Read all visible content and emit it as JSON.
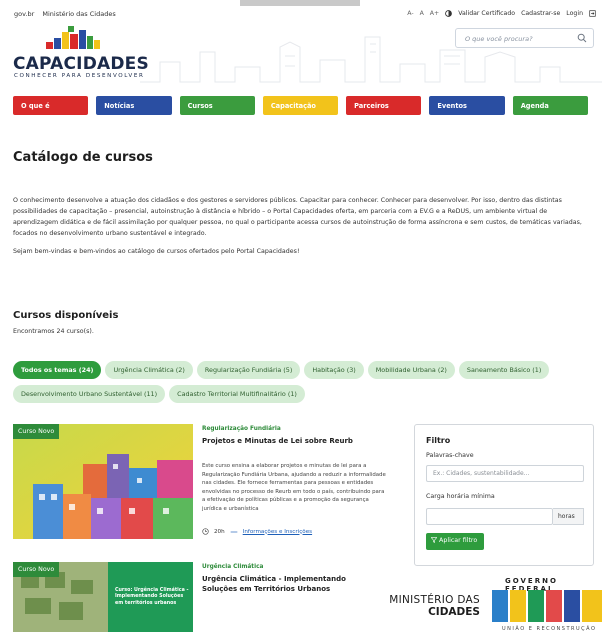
{
  "govbar": {
    "left_links": [
      "gov.br",
      "Ministério das Cidades"
    ],
    "a_minus": "A-",
    "a_normal": "A",
    "a_plus": "A+",
    "contrast_icon": "contrast-icon",
    "validar": "Validar Certificado",
    "cadastrar": "Cadastrar-se",
    "login": "Login"
  },
  "header": {
    "logo_title": "CAPACIDADES",
    "logo_subtitle": "CONHECER PARA DESENVOLVER",
    "search_placeholder": "O que você procura?"
  },
  "nav": [
    {
      "label": "O que é",
      "color": "#d92a2a"
    },
    {
      "label": "Notícias",
      "color": "#2a4ea2"
    },
    {
      "label": "Cursos",
      "color": "#3b9c3e"
    },
    {
      "label": "Capacitação",
      "color": "#f2c31b"
    },
    {
      "label": "Parceiros",
      "color": "#d92a2a"
    },
    {
      "label": "Eventos",
      "color": "#2a4ea2"
    },
    {
      "label": "Agenda",
      "color": "#3b9c3e"
    }
  ],
  "main": {
    "title": "Catálogo de cursos",
    "intro": "O conhecimento desenvolve a atuação dos cidadãos e dos gestores e servidores públicos. Capacitar para conhecer. Conhecer para desenvolver. Por isso, dentro das distintas possibilidades de capacitação – presencial, autoinstrução à distância e híbrido – o Portal Capacidades oferta, em parceria com a EV.G e a ReDUS, um ambiente virtual de aprendizagem didática e de fácil assimilação por qualquer pessoa, no qual o participante acessa cursos de autoinstrução de forma assíncrona e sem custos, de temáticas variadas, focados no desenvolvimento urbano sustentável e integrado.",
    "welcome": "Sejam bem-vindas e bem-vindos ao catálogo de cursos ofertados pelo Portal Capacidades!",
    "available_title": "Cursos disponíveis",
    "found": "Encontramos 24 curso(s)."
  },
  "chips": [
    {
      "label": "Todos os temas (24)",
      "active": true
    },
    {
      "label": "Urgência Climática (2)"
    },
    {
      "label": "Regularização Fundiária (5)"
    },
    {
      "label": "Habitação (3)"
    },
    {
      "label": "Mobilidade Urbana (2)"
    },
    {
      "label": "Saneamento Básico (1)"
    },
    {
      "label": "Desenvolvimento Urbano Sustentável (11)"
    },
    {
      "label": "Cadastro Territorial Multifinalitário (1)"
    }
  ],
  "courses": [
    {
      "badge": "Curso Novo",
      "category": "Regularização Fundiária",
      "title": "Projetos e Minutas de Lei sobre Reurb",
      "description": "Este curso ensina a elaborar projetos e minutas de lei para a Regularização Fundiária Urbana, ajudando a reduzir a informalidade nas cidades. Ele fornece ferramentas para pessoas e entidades envolvidas no processo de Reurb em todo o país, contribuindo para a efetivação de políticas públicas e a promoção da segurança jurídica e urbanística",
      "hours": "20h",
      "info_link": "Informações e Inscrições"
    },
    {
      "badge": "Curso Novo",
      "category": "Urgência Climática",
      "title": "Urgência Climática - Implementando Soluções em Territórios Urbanos",
      "image_caption": "Curso: Urgência Climática - Implementando Soluções em territórios urbanos"
    }
  ],
  "filter": {
    "title": "Filtro",
    "keywords_label": "Palavras-chave",
    "keywords_placeholder": "Ex.: Cidades, sustentabilidade...",
    "hours_label": "Carga horária mínima",
    "hours_unit": "horas",
    "apply_label": "Aplicar filtro"
  },
  "footer": {
    "ministerio_line1": "MINISTÉRIO DAS",
    "ministerio_line2": "CIDADES",
    "gov_federal": "GOVERNO FEDERAL",
    "brasil": "BRASIL",
    "uniao": "UNIÃO E RECONSTRUÇÃO"
  }
}
